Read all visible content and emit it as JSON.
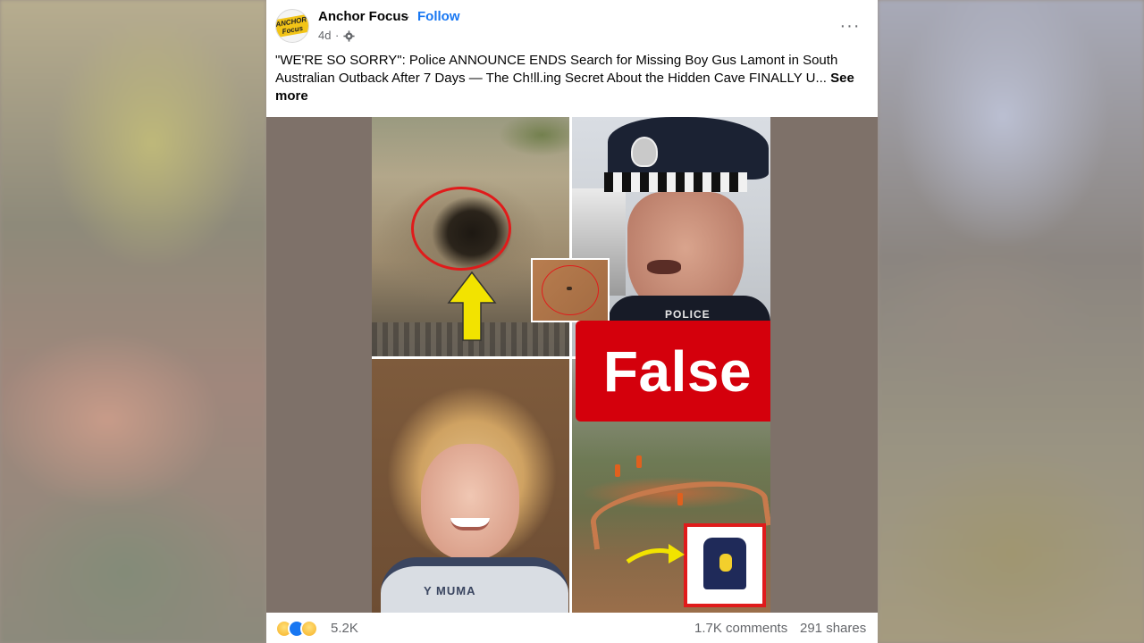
{
  "post": {
    "page_name": "Anchor Focus",
    "separator": "·",
    "follow_label": "Follow",
    "time": "4d",
    "audience_icon": "gear-icon",
    "more_icon": "···",
    "avatar_text": "ANCHOR Focus",
    "caption": "\"WE'RE SO SORRY\": Police ANNOUNCE ENDS Search for Missing Boy Gus Lamont in South Australian Outback After 7 Days — The Ch!ll.ing Secret About the Hidden Cave FINALLY U...",
    "see_more_label": "See more"
  },
  "media": {
    "police_label": "POLICE",
    "shirt_text": "Y MUMA",
    "rating_label": "False",
    "colors": {
      "rating_bg": "#d4000c",
      "circle": "#e01b1b",
      "arrow": "#f2e300"
    }
  },
  "footer": {
    "reaction_icons": [
      "sad-reaction-icon",
      "like-reaction-icon",
      "care-reaction-icon"
    ],
    "reaction_count": "5.2K",
    "comments": "1.7K comments",
    "shares": "291 shares"
  }
}
